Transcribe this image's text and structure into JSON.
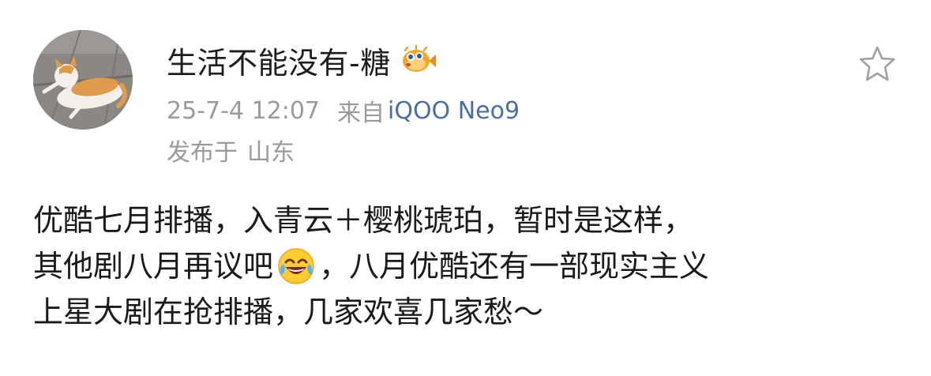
{
  "post": {
    "author": {
      "name": "生活不能没有-糖",
      "avatar_icon": "cat-avatar",
      "badge_icon": "pufferfish-icon"
    },
    "timestamp": "25-7-4 12:07",
    "source_prefix": "来自",
    "source_device": "iQOO Neo9",
    "location_prefix": "发布于",
    "location": "山东",
    "favorite_icon": "star-outline-icon",
    "content": {
      "line1": "优酷七月排播，入青云＋樱桃琥珀，暂时是这样，",
      "line2_before": "其他剧八月再议吧",
      "line2_emoji": "laughing-tears-emoji-icon",
      "line2_after": "，八月优酷还有一部现实主义",
      "line3": "上星大剧在抢排播，几家欢喜几家愁～"
    }
  },
  "colors": {
    "text_primary": "#1a1a1a",
    "text_secondary": "#9a9a9a",
    "link_blue": "#4a6fa5"
  }
}
